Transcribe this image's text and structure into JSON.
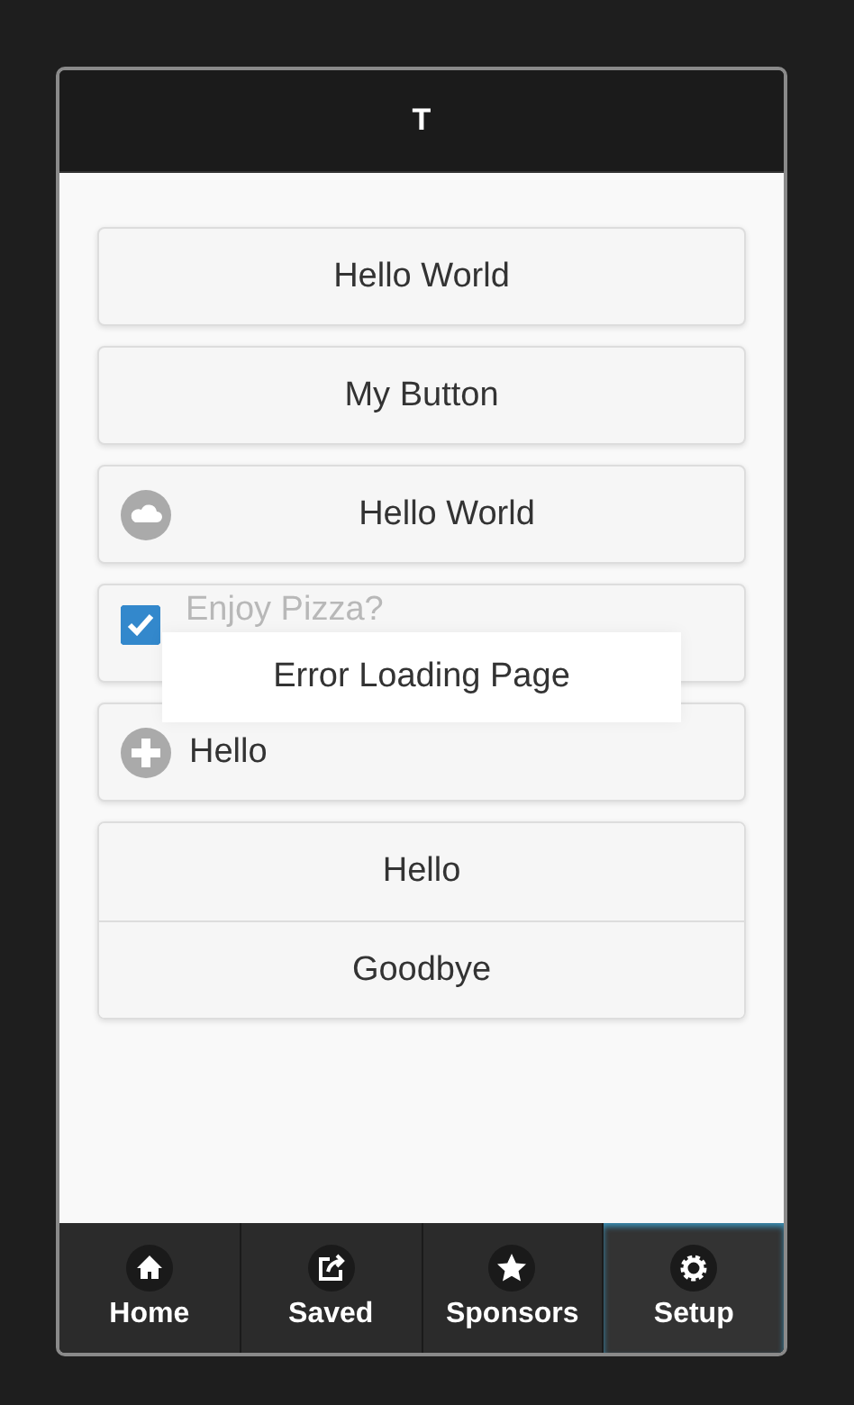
{
  "header": {
    "title": "T"
  },
  "items": [
    {
      "kind": "button",
      "label": "Hello World"
    },
    {
      "kind": "button",
      "label": "My Button"
    },
    {
      "kind": "icon-button",
      "label": "Hello World"
    },
    {
      "kind": "checkbox",
      "label": "Enjoy Pizza?",
      "checked": true
    },
    {
      "kind": "icon-button-left",
      "label": "Hello"
    },
    {
      "kind": "group",
      "labels": [
        "Hello",
        "Goodbye"
      ]
    }
  ],
  "overlay": {
    "message": "Error Loading Page"
  },
  "navbar": [
    {
      "label": "Home",
      "selected": false
    },
    {
      "label": "Saved",
      "selected": false
    },
    {
      "label": "Sponsors",
      "selected": false
    },
    {
      "label": "Setup",
      "selected": true
    }
  ]
}
